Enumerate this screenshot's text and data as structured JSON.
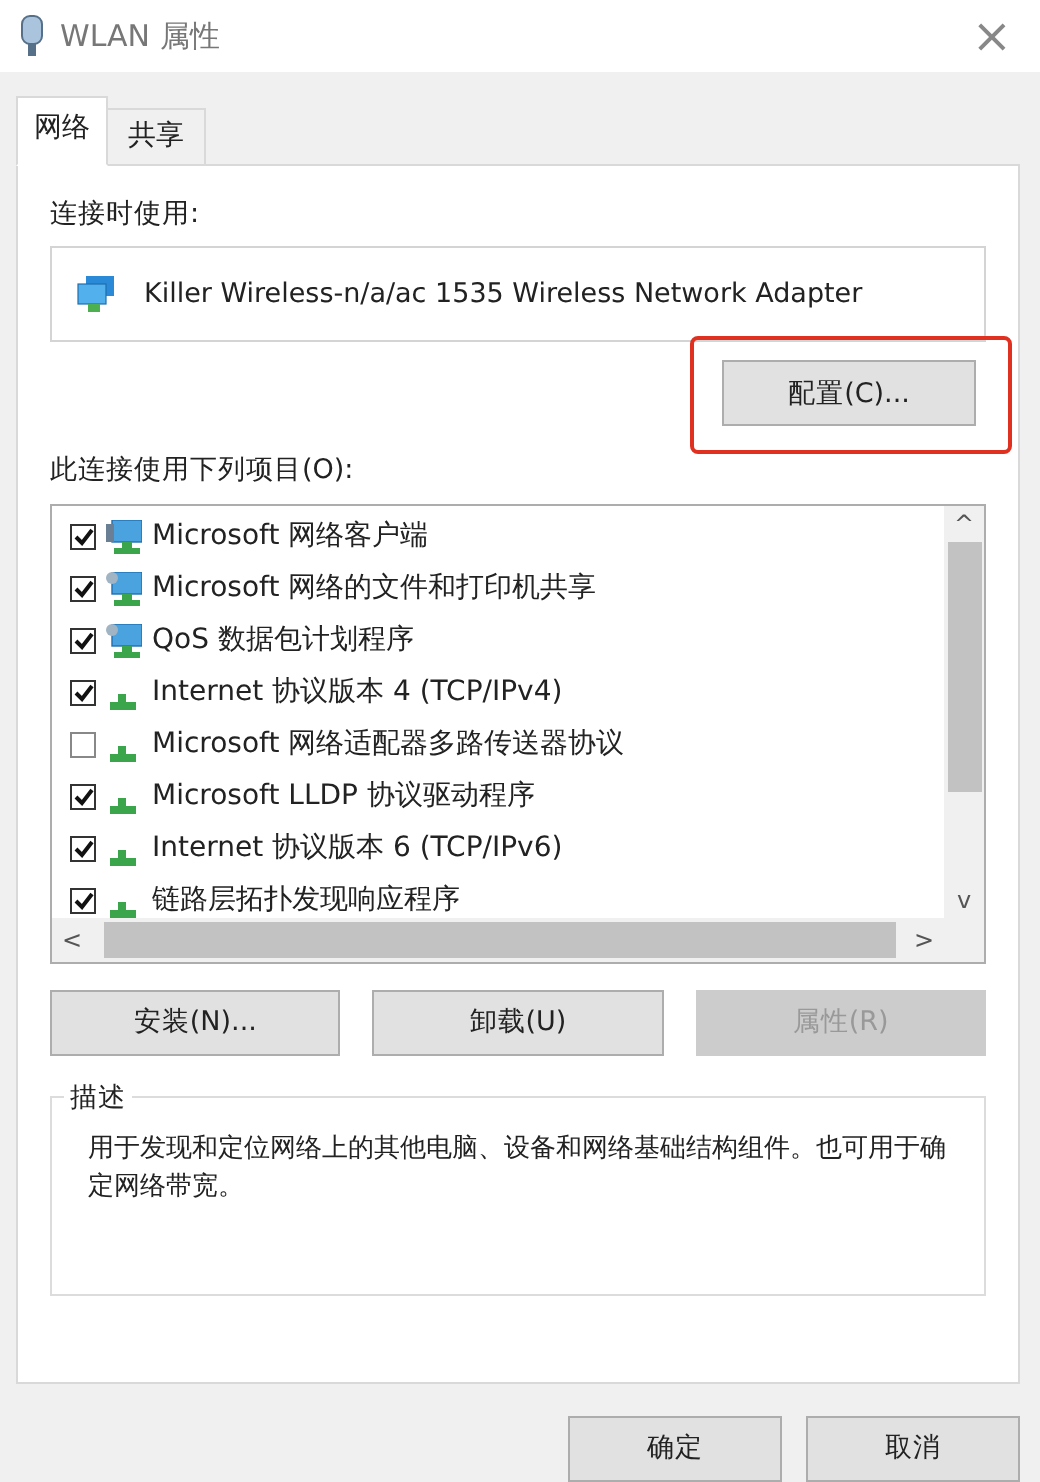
{
  "window": {
    "title": "WLAN 属性",
    "close": "×"
  },
  "tabs": [
    {
      "label": "网络",
      "selected": true
    },
    {
      "label": "共享",
      "selected": false
    }
  ],
  "connect_using": {
    "label": "连接时使用:",
    "adapter": "Killer Wireless-n/a/ac 1535 Wireless Network Adapter"
  },
  "configure_button": {
    "label": "配置(C)...",
    "highlighted": true
  },
  "items_label": "此连接使用下列项目(O):",
  "items": [
    {
      "label": "Microsoft 网络客户端",
      "checked": true,
      "kind": "client"
    },
    {
      "label": "Microsoft 网络的文件和打印机共享",
      "checked": true,
      "kind": "service"
    },
    {
      "label": "QoS 数据包计划程序",
      "checked": true,
      "kind": "service"
    },
    {
      "label": "Internet 协议版本 4 (TCP/IPv4)",
      "checked": true,
      "kind": "protocol"
    },
    {
      "label": "Microsoft 网络适配器多路传送器协议",
      "checked": false,
      "kind": "protocol"
    },
    {
      "label": "Microsoft LLDP 协议驱动程序",
      "checked": true,
      "kind": "protocol"
    },
    {
      "label": "Internet 协议版本 6 (TCP/IPv6)",
      "checked": true,
      "kind": "protocol"
    },
    {
      "label": "链路层拓扑发现响应程序",
      "checked": true,
      "kind": "protocol"
    }
  ],
  "scroll_arrows": {
    "up": "^",
    "down": "v",
    "left": "<",
    "right": ">"
  },
  "item_buttons": [
    {
      "label": "安装(N)...",
      "disabled": false
    },
    {
      "label": "卸载(U)",
      "disabled": false
    },
    {
      "label": "属性(R)",
      "disabled": true
    }
  ],
  "description": {
    "title": "描述",
    "text": "用于发现和定位网络上的其他电脑、设备和网络基础结构组件。也可用于确定网络带宽。"
  },
  "dialog_buttons": [
    {
      "label": "确定"
    },
    {
      "label": "取消"
    }
  ]
}
